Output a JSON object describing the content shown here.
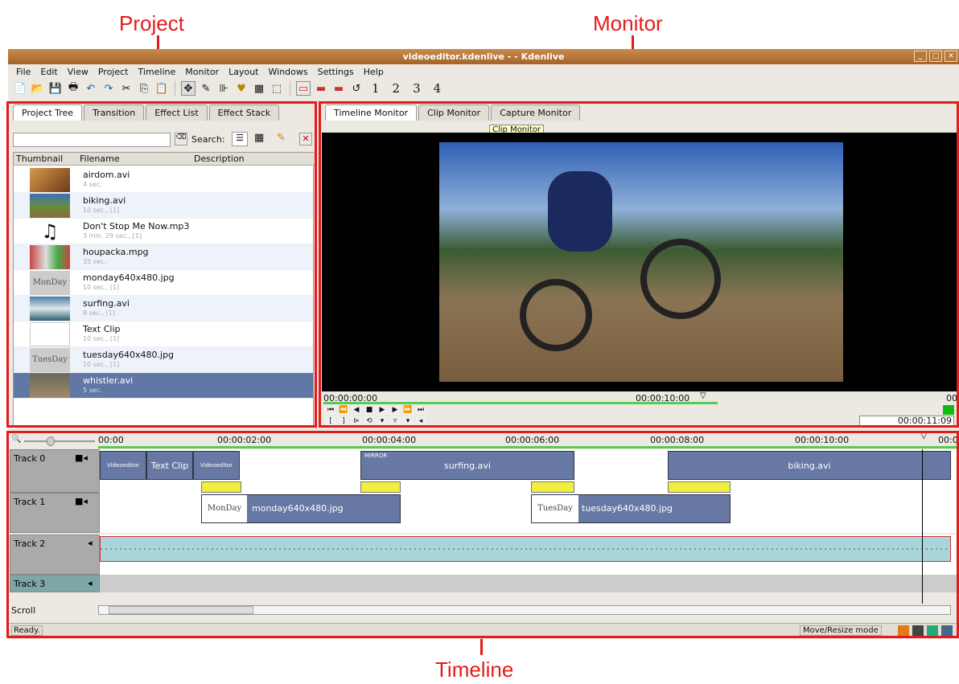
{
  "callouts": {
    "project": "Project",
    "monitor": "Monitor",
    "timeline": "Timeline"
  },
  "window": {
    "title": "videoeditor.kdenlive - - Kdenlive"
  },
  "menu": [
    "File",
    "Edit",
    "View",
    "Project",
    "Timeline",
    "Monitor",
    "Layout",
    "Windows",
    "Settings",
    "Help"
  ],
  "toolbar": {
    "layout_numbers": [
      "1",
      "2",
      "3",
      "4"
    ]
  },
  "project": {
    "tabs": [
      "Project Tree",
      "Transition",
      "Effect List",
      "Effect Stack"
    ],
    "search_label": "Search:",
    "columns": [
      "Thumbnail",
      "Filename",
      "Description"
    ],
    "items": [
      {
        "name": "airdom.avi",
        "sub": "4 sec."
      },
      {
        "name": "biking.avi",
        "sub": "10 sec., [1]"
      },
      {
        "name": "Don't Stop Me Now.mp3",
        "sub": "3 min. 29 sec., [1]"
      },
      {
        "name": "houpacka.mpg",
        "sub": "35 sec."
      },
      {
        "name": "monday640x480.jpg",
        "sub": "10 sec., [1]"
      },
      {
        "name": "surfing.avi",
        "sub": "8 sec., [1]"
      },
      {
        "name": "Text Clip",
        "sub": "10 sec., [1]"
      },
      {
        "name": "tuesday640x480.jpg",
        "sub": "10 sec., [1]"
      },
      {
        "name": "whistler.avi",
        "sub": "5 sec."
      }
    ]
  },
  "monitor": {
    "tabs": [
      "Timeline Monitor",
      "Clip Monitor",
      "Capture Monitor"
    ],
    "tooltip": "Clip Monitor",
    "ruler_start": "00:00:00:00",
    "ruler_mid": "00:00:10:00",
    "ruler_end": "00",
    "timecode": "00:00:11:09"
  },
  "timeline": {
    "ruler": [
      "00:00",
      "00:00:02:00",
      "00:00:04:00",
      "00:00:06:00",
      "00:00:08:00",
      "00:00:10:00",
      "00:0"
    ],
    "tracks": [
      "Track 0",
      "Track 1",
      "Track 2",
      "Track 3"
    ],
    "clips": {
      "text_clip": "Text Clip",
      "surfing": "surfing.avi",
      "biking": "biking.avi",
      "monday": "monday640x480.jpg",
      "tuesday": "tuesday640x480.jpg",
      "mirror": "MIRROR",
      "videoeditor": "Videoeditor",
      "monday_thumb": "MonDay",
      "tuesday_thumb": "TuesDay"
    },
    "scroll_label": "Scroll"
  },
  "status": {
    "text": "Ready.",
    "mode": "Move/Resize mode"
  }
}
